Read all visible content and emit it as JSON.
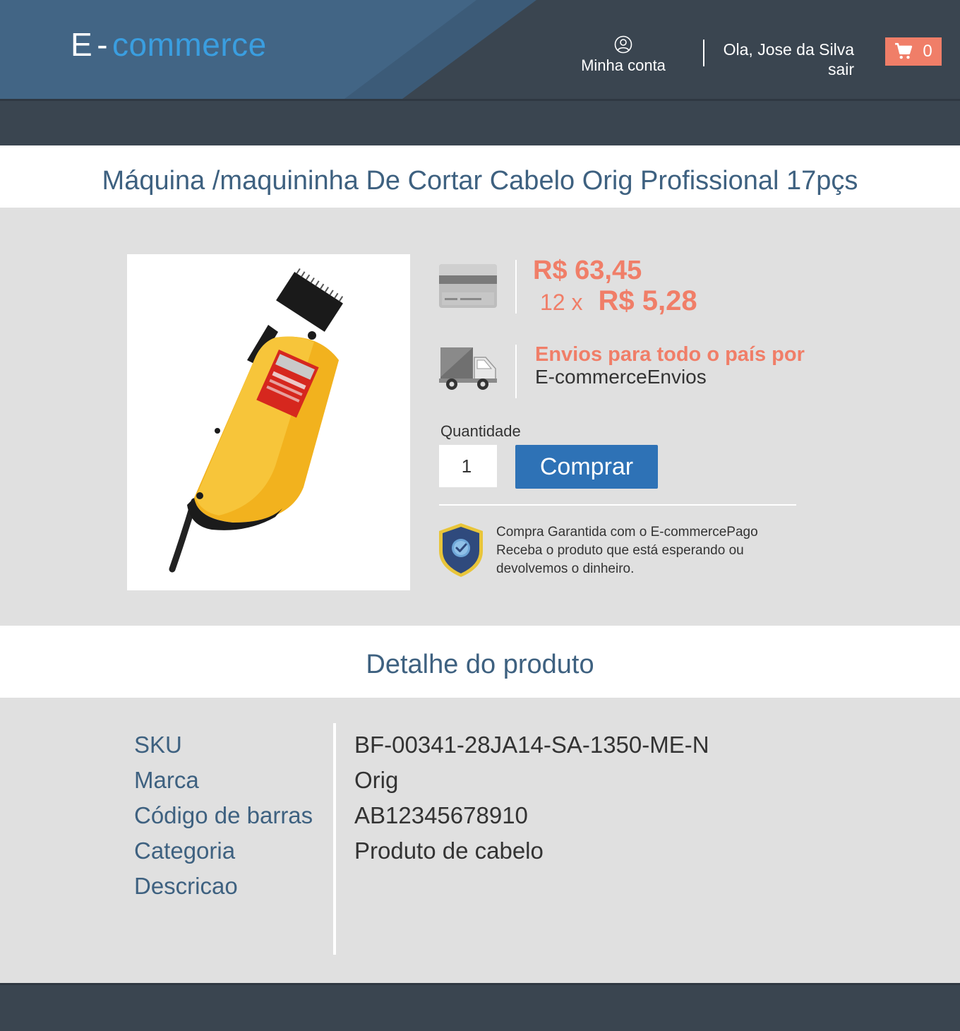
{
  "header": {
    "logo_prefix": "E",
    "logo_dash": "-",
    "logo_accent": "commerce",
    "account_label": "Minha conta",
    "greeting": "Ola, Jose da Silva",
    "logout": "sair",
    "cart_count": "0"
  },
  "product": {
    "title": "Máquina /maquininha De Cortar Cabelo Orig Profissional 17pçs",
    "price": "R$ 63,45",
    "installments_count": "12 x",
    "installment_value": "R$ 5,28",
    "shipping_line1": "Envios para todo o país por",
    "shipping_line2": "E-commerceEnvios",
    "quantity_label": "Quantidade",
    "quantity_value": "1",
    "buy_label": "Comprar",
    "guarantee_line1": "Compra Garantida com o E-commercePago",
    "guarantee_line2": "Receba o produto que está esperando ou",
    "guarantee_line3": "devolvemos o dinheiro."
  },
  "details": {
    "heading": "Detalhe do produto",
    "labels": [
      "SKU",
      "Marca",
      "Código de barras",
      "Categoria",
      "Descricao"
    ],
    "values": [
      "BF-00341-28JA14-SA-1350-ME-N",
      "Orig",
      "AB12345678910",
      "Produto de cabelo",
      ""
    ]
  },
  "colors": {
    "header_bg": "#3a4550",
    "accent_blue": "#3a9ee0",
    "price_orange": "#f07e68",
    "button_blue": "#2e72b6",
    "title_blue": "#3e6180"
  },
  "icons": {
    "account": "user-circle-icon",
    "cart": "shopping-cart-icon",
    "payment": "credit-card-icon",
    "shipping": "truck-icon",
    "guarantee": "shield-check-icon"
  }
}
